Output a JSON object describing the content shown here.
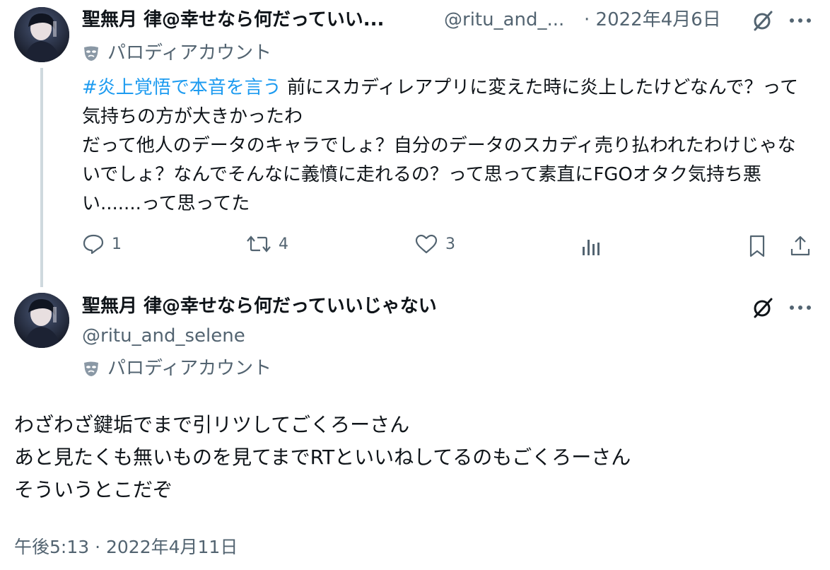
{
  "parent_tweet": {
    "display_name": "聖無月 律@幸せなら何だっていい...",
    "handle": "@ritu_and_...",
    "date": "· 2022年4月6日",
    "account_label": "パロディアカウント",
    "hashtag": "#炎上覚悟で本音を言う",
    "text_after_hashtag": " 前にスカディレアプリに変えた時に炎上したけどなんで？って気持ちの方が大きかったわ\nだって他人のデータのキャラでしょ？自分のデータのスカディ売り払われたわけじゃないでしょ？なんでそんなに義憤に走れるの？って思って素直にFGOオタク気持ち悪い.......って思ってた",
    "replies": "1",
    "retweets": "4",
    "likes": "3",
    "icons": {
      "reply": "reply-icon",
      "retweet": "retweet-icon",
      "like": "heart-icon",
      "views": "analytics-icon",
      "bookmark": "bookmark-icon",
      "share": "share-icon",
      "grok": "grok-icon",
      "more": "more-icon",
      "parody": "mask-icon"
    }
  },
  "main_tweet": {
    "display_name": "聖無月 律@幸せなら何だっていいじゃない",
    "handle": "@ritu_and_selene",
    "account_label": "パロディアカウント",
    "text": "わざわざ鍵垢でまで引リツしてごくろーさん\nあと見たくも無いものを見てまでRTといいねしてるのもごくろーさん\nそういうとこだぞ",
    "timestamp": "午後5:13 · 2022年4月11日"
  },
  "colors": {
    "accent": "#1d9bf0",
    "secondary_text": "#536471",
    "thread_line": "#cfd9de"
  }
}
